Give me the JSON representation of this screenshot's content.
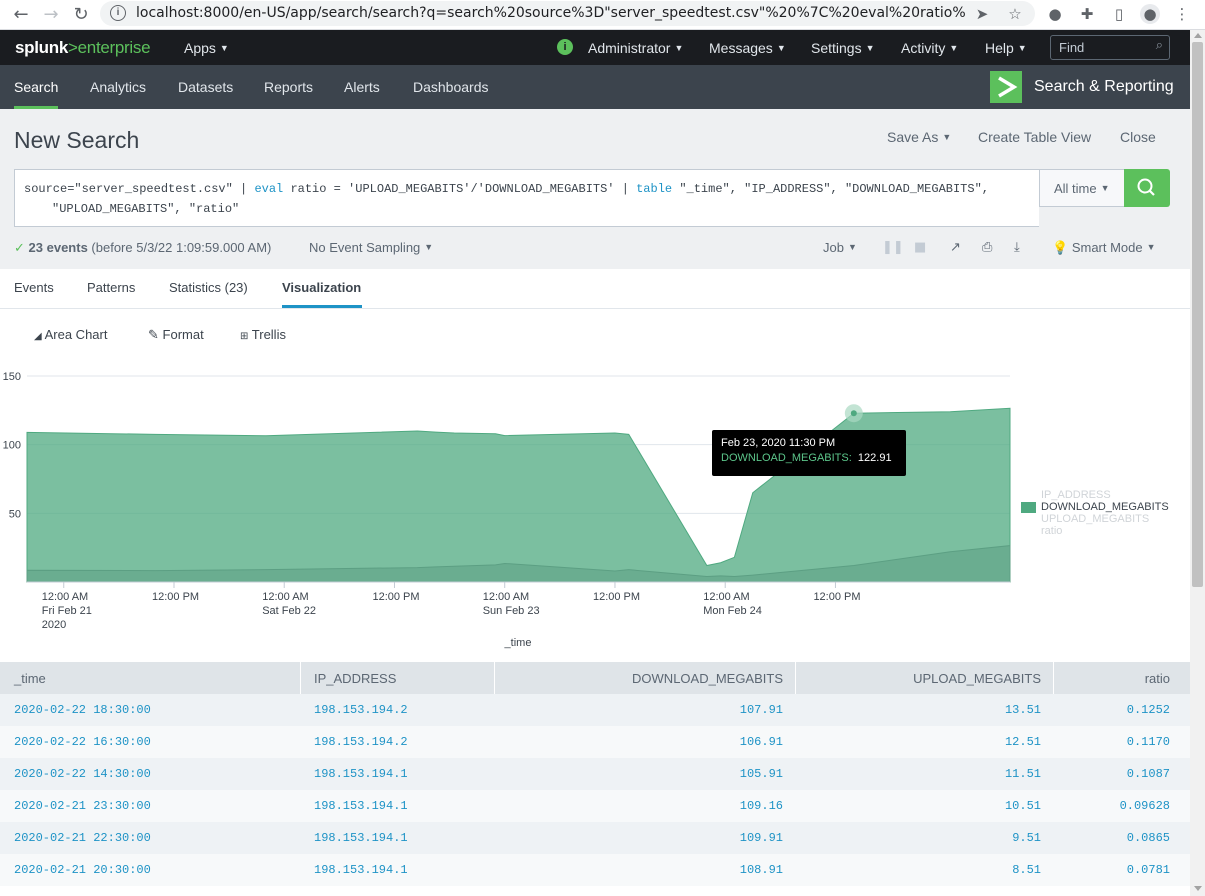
{
  "browser": {
    "url": "localhost:8000/en-US/app/search/search?q=search%20source%3D\"server_speedtest.csv\"%20%7C%20eval%20ratio%20%3D%2..."
  },
  "topbar": {
    "logo_splunk": "splunk",
    "logo_gt": ">",
    "logo_enterprise": "enterprise",
    "apps": "Apps",
    "administrator": "Administrator",
    "messages": "Messages",
    "settings": "Settings",
    "activity": "Activity",
    "help": "Help",
    "find_placeholder": "Find"
  },
  "appbar": {
    "tabs": [
      "Search",
      "Analytics",
      "Datasets",
      "Reports",
      "Alerts",
      "Dashboards"
    ],
    "title": "Search & Reporting"
  },
  "search": {
    "page_title": "New Search",
    "save_as": "Save As",
    "create_table_view": "Create Table View",
    "close": "Close",
    "query_part1": "source=\"server_speedtest.csv\" | ",
    "query_eval": "eval",
    "query_part2": " ratio = 'UPLOAD_MEGABITS'/'DOWNLOAD_MEGABITS' | ",
    "query_table": "table",
    "query_part3": " \"_time\", \"IP_ADDRESS\", \"DOWNLOAD_MEGABITS\",",
    "query_line2": "\"UPLOAD_MEGABITS\", \"ratio\"",
    "time_range": "All time",
    "events_count": "23 events",
    "events_before": "(before 5/3/22 1:09:59.000 AM)",
    "sampling": "No Event Sampling",
    "job": "Job",
    "mode": "Smart Mode"
  },
  "tabs": {
    "events": "Events",
    "patterns": "Patterns",
    "statistics": "Statistics (23)",
    "visualization": "Visualization"
  },
  "viz_toolbar": {
    "chart_type": "Area Chart",
    "format": "Format",
    "trellis": "Trellis"
  },
  "chart_data": {
    "type": "area",
    "xlabel": "_time",
    "ylabel": "",
    "ylim": [
      0,
      150
    ],
    "y_ticks": [
      "150",
      "100",
      "50"
    ],
    "x_ticks": [
      {
        "l1": "12:00 AM",
        "l2": "Fri Feb 21",
        "l3": "2020"
      },
      {
        "l1": "12:00 PM",
        "l2": "",
        "l3": ""
      },
      {
        "l1": "12:00 AM",
        "l2": "Sat Feb 22",
        "l3": ""
      },
      {
        "l1": "12:00 PM",
        "l2": "",
        "l3": ""
      },
      {
        "l1": "12:00 AM",
        "l2": "Sun Feb 23",
        "l3": ""
      },
      {
        "l1": "12:00 PM",
        "l2": "",
        "l3": ""
      },
      {
        "l1": "12:00 AM",
        "l2": "Mon Feb 24",
        "l3": ""
      },
      {
        "l1": "12:00 PM",
        "l2": "",
        "l3": ""
      }
    ],
    "x_hours": [
      -4,
      10,
      22,
      38.5,
      40.5,
      42.5,
      47,
      48,
      60,
      61.5,
      70,
      71.5,
      73,
      75,
      86,
      96.5,
      103
    ],
    "series": [
      {
        "name": "DOWNLOAD_MEGABITS",
        "color": "#4fa980",
        "values": [
          108.91,
          107.5,
          106.5,
          109.91,
          109.16,
          108.5,
          107.91,
          106.6,
          108.5,
          107.5,
          12,
          14,
          18,
          65,
          122.91,
          124,
          126.5
        ]
      },
      {
        "name": "UPLOAD_MEGABITS",
        "color": "#5c9f83",
        "values": [
          8.51,
          8.3,
          9,
          10.51,
          11,
          11.51,
          12.5,
          13.51,
          8,
          9,
          4,
          4.5,
          4,
          5,
          12,
          22,
          26.5
        ]
      }
    ],
    "legend": [
      "IP_ADDRESS",
      "DOWNLOAD_MEGABITS",
      "UPLOAD_MEGABITS",
      "ratio"
    ],
    "legend_position": "right"
  },
  "tooltip": {
    "date": "Feb 23, 2020 11:30 PM",
    "label": "DOWNLOAD_MEGABITS:",
    "value": "122.91"
  },
  "table": {
    "headers": [
      "_time",
      "IP_ADDRESS",
      "DOWNLOAD_MEGABITS",
      "UPLOAD_MEGABITS",
      "ratio"
    ],
    "rows": [
      [
        "2020-02-22 18:30:00",
        "198.153.194.2",
        "107.91",
        "13.51",
        "0.1252"
      ],
      [
        "2020-02-22 16:30:00",
        "198.153.194.2",
        "106.91",
        "12.51",
        "0.1170"
      ],
      [
        "2020-02-22 14:30:00",
        "198.153.194.1",
        "105.91",
        "11.51",
        "0.1087"
      ],
      [
        "2020-02-21 23:30:00",
        "198.153.194.1",
        "109.16",
        "10.51",
        "0.09628"
      ],
      [
        "2020-02-21 22:30:00",
        "198.153.194.1",
        "109.91",
        "9.51",
        "0.0865"
      ],
      [
        "2020-02-21 20:30:00",
        "198.153.194.1",
        "108.91",
        "8.51",
        "0.0781"
      ]
    ]
  }
}
